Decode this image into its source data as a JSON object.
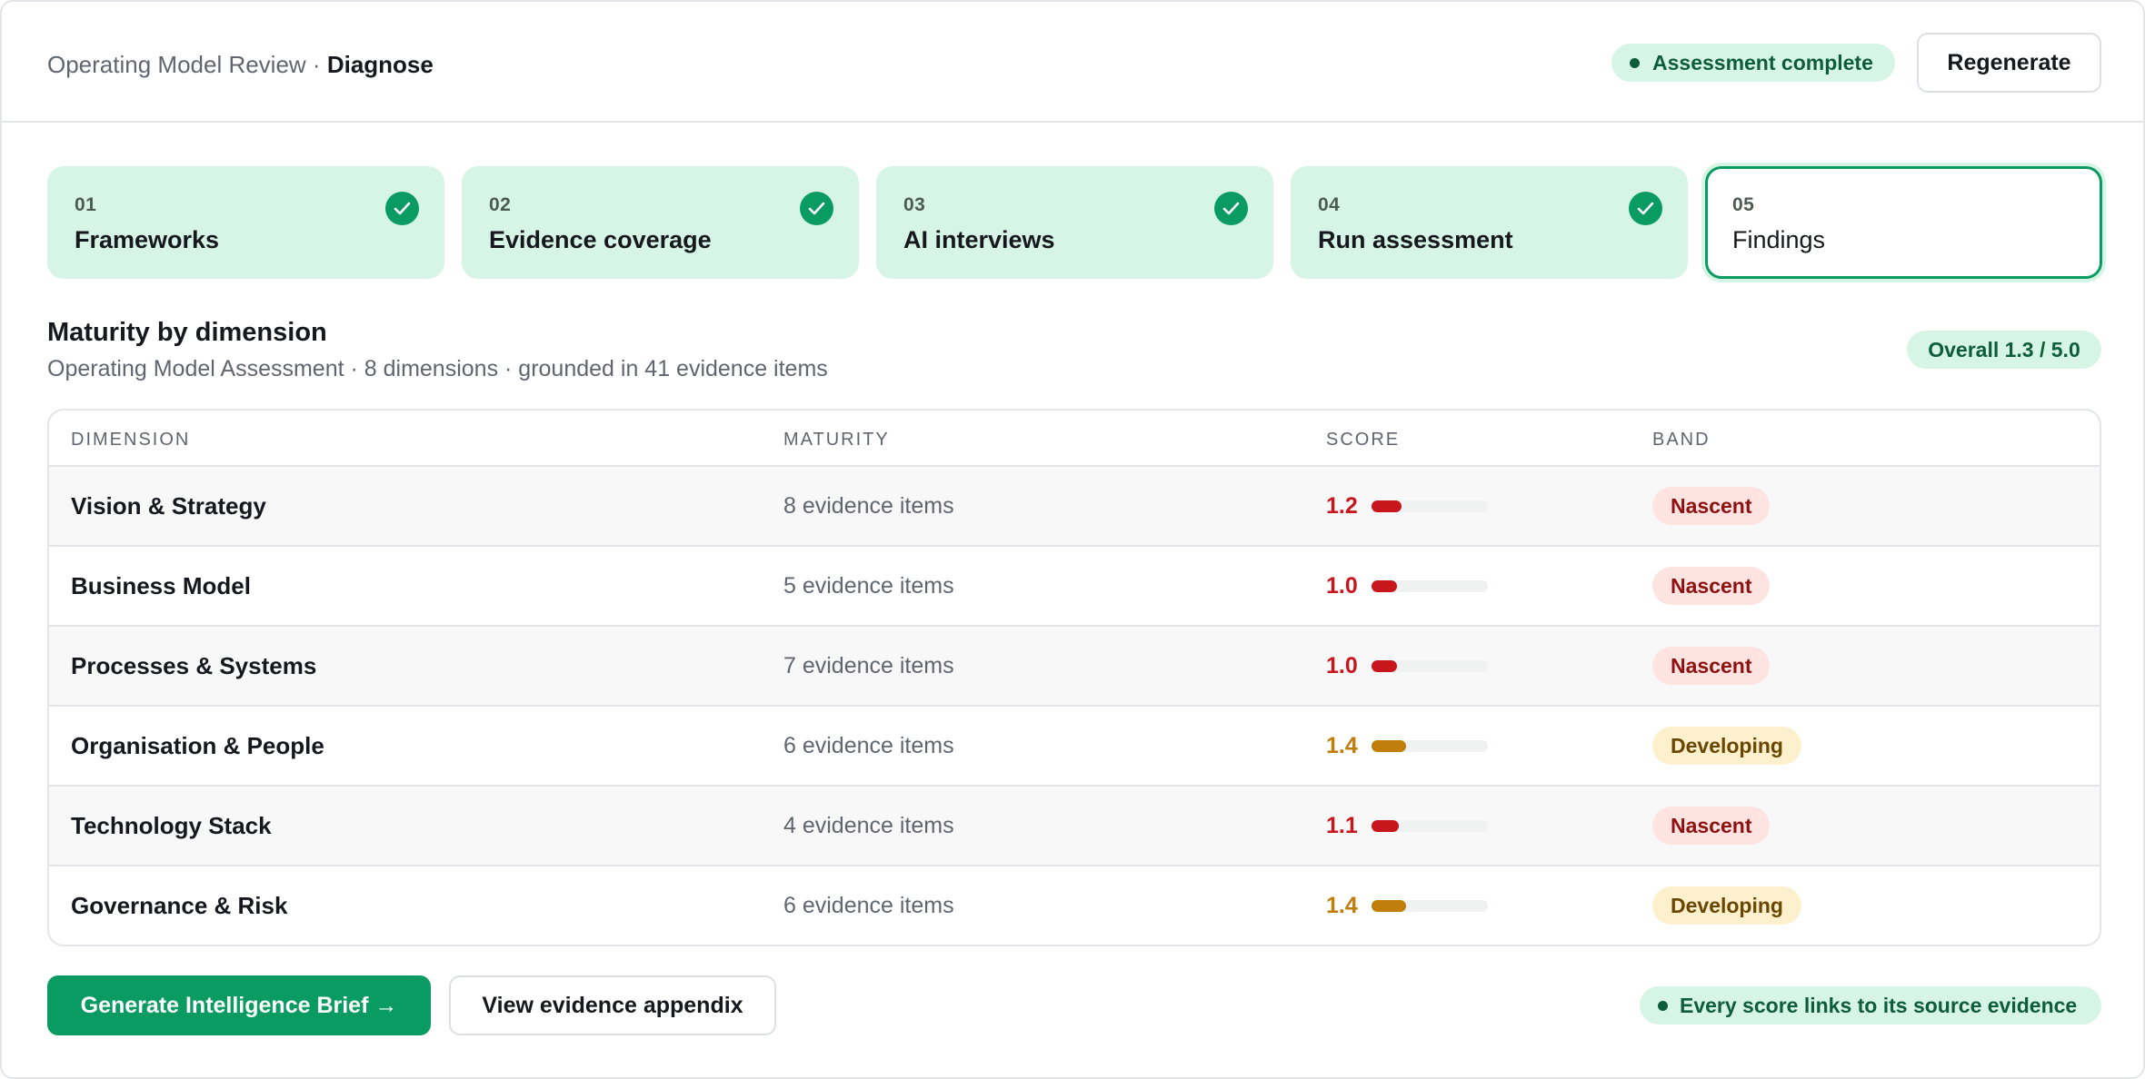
{
  "header": {
    "breadcrumb_parent": "Operating Model Review",
    "breadcrumb_sep": " · ",
    "breadcrumb_current": "Diagnose",
    "status": "Assessment complete",
    "regenerate_label": "Regenerate"
  },
  "steps": [
    {
      "num": "01",
      "label": "Frameworks",
      "state": "complete"
    },
    {
      "num": "02",
      "label": "Evidence coverage",
      "state": "complete"
    },
    {
      "num": "03",
      "label": "AI interviews",
      "state": "complete"
    },
    {
      "num": "04",
      "label": "Run assessment",
      "state": "complete"
    },
    {
      "num": "05",
      "label": "Findings",
      "state": "active"
    }
  ],
  "section": {
    "title": "Maturity by dimension",
    "subtitle": "Operating Model Assessment · 8 dimensions · grounded in 41 evidence items",
    "overall": "Overall 1.3 / 5.0"
  },
  "table": {
    "columns": [
      "DIMENSION",
      "MATURITY",
      "SCORE",
      "BAND"
    ],
    "rows": [
      {
        "dimension": "Vision & Strategy",
        "maturity": "8 evidence items",
        "score": "1.2",
        "score_value": 1.2,
        "band": "Nascent"
      },
      {
        "dimension": "Business Model",
        "maturity": "5 evidence items",
        "score": "1.0",
        "score_value": 1.0,
        "band": "Nascent"
      },
      {
        "dimension": "Processes & Systems",
        "maturity": "7 evidence items",
        "score": "1.0",
        "score_value": 1.0,
        "band": "Nascent"
      },
      {
        "dimension": "Organisation & People",
        "maturity": "6 evidence items",
        "score": "1.4",
        "score_value": 1.4,
        "band": "Developing"
      },
      {
        "dimension": "Technology Stack",
        "maturity": "4 evidence items",
        "score": "1.1",
        "score_value": 1.1,
        "band": "Nascent"
      },
      {
        "dimension": "Governance & Risk",
        "maturity": "6 evidence items",
        "score": "1.4",
        "score_value": 1.4,
        "band": "Developing"
      }
    ]
  },
  "footer": {
    "primary_label": "Generate Intelligence Brief →",
    "secondary_label": "View evidence appendix",
    "note": "Every score links to its source evidence"
  },
  "colors": {
    "accent": "#0a9b62",
    "accent_light": "#d7f5e6",
    "nascent_text": "#8f1010",
    "nascent_bg": "#fde4e1",
    "nascent_score": "#c8161d",
    "developing_text": "#6b4600",
    "developing_bg": "#fdf0cc",
    "developing_score": "#c07e0a"
  }
}
